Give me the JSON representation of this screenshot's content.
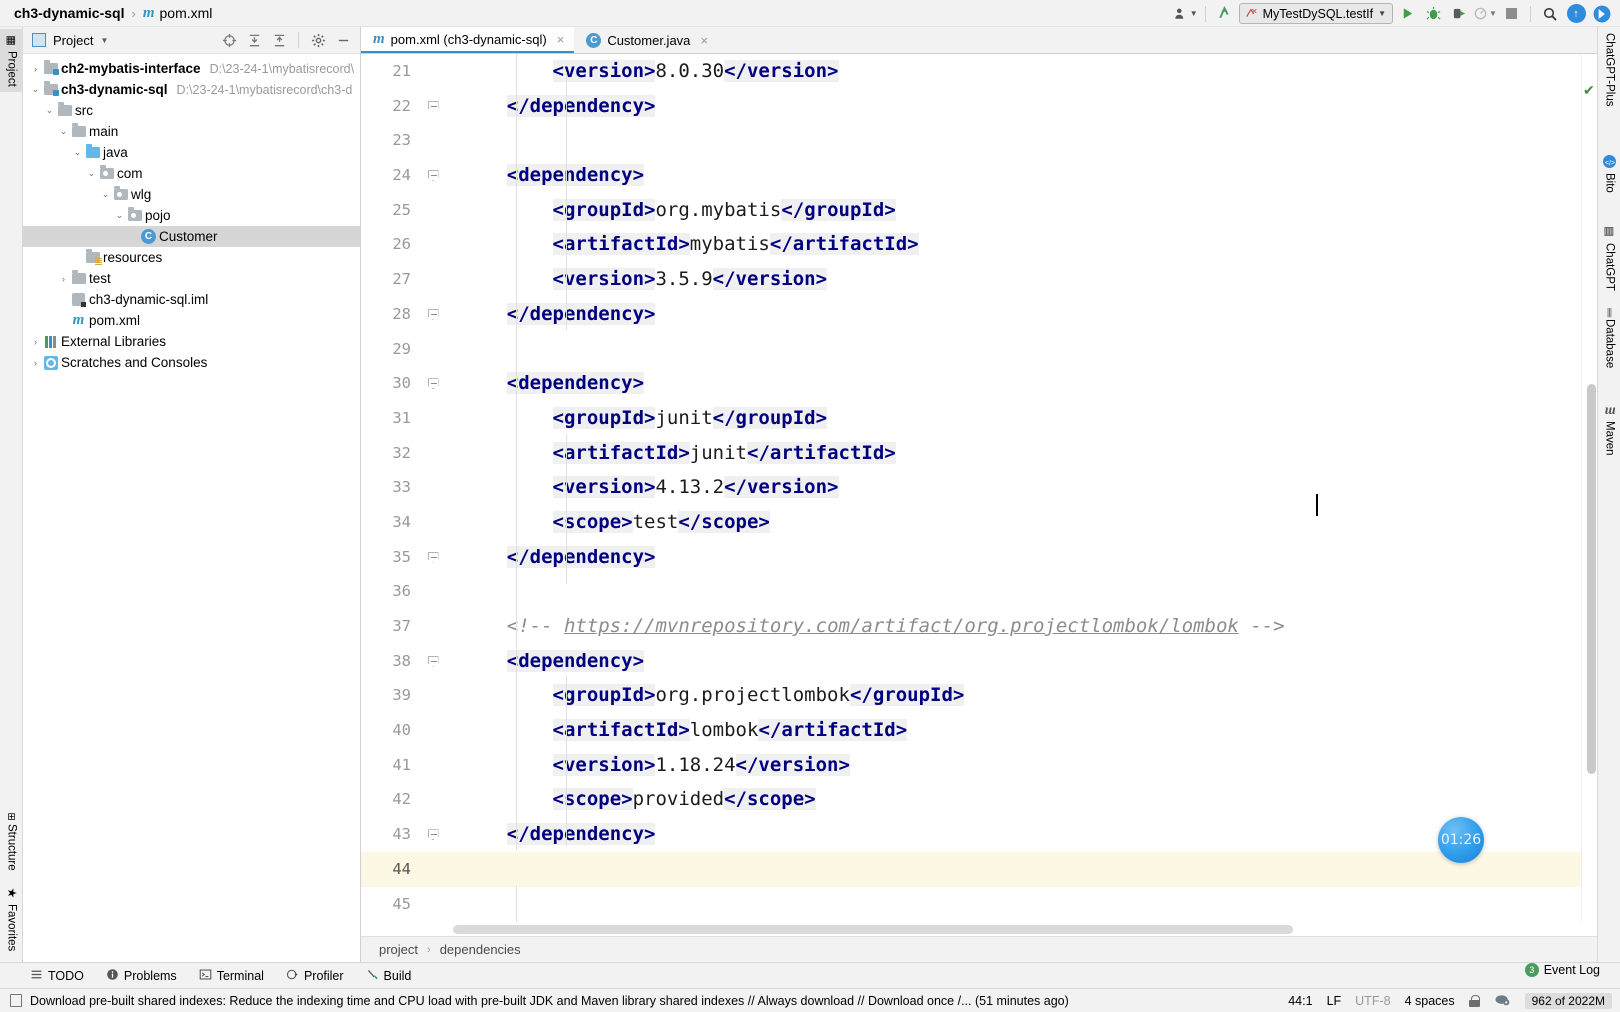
{
  "titlebar": {
    "project": "ch3-dynamic-sql",
    "separator": "›",
    "file": "pom.xml",
    "maven_icon": "m",
    "run_config": "MyTestDySQL.testIf",
    "icons": {
      "user": "user-icon",
      "updates": "update-arrow-icon",
      "run": "▶",
      "debug": "debug-icon",
      "run_coverage": "run-with-coverage-icon",
      "profile": "profile-icon",
      "stop": "stop-icon",
      "search": "⌕",
      "upload": "⬆",
      "forward": "➤"
    }
  },
  "left_rail": {
    "top": "Project",
    "bottom": [
      "Structure",
      "Favorites"
    ]
  },
  "project_panel": {
    "title": "Project",
    "toolbar_icons": [
      "locate-icon",
      "expand-all-icon",
      "collapse-all-icon",
      "settings-gear-icon",
      "hide-icon"
    ],
    "tree": [
      {
        "label": "ch2-mybatis-interface",
        "path": "D:\\23-24-1\\mybatisrecord\\",
        "arrow": "›",
        "icon": "module-folder",
        "indent": 0,
        "bold": true,
        "selected": false
      },
      {
        "label": "ch3-dynamic-sql",
        "path": "D:\\23-24-1\\mybatisrecord\\ch3-d",
        "arrow": "⌄",
        "icon": "module-folder",
        "indent": 0,
        "bold": true,
        "selected": false
      },
      {
        "label": "src",
        "path": "",
        "arrow": "⌄",
        "icon": "folder",
        "indent": 1,
        "bold": false,
        "selected": false
      },
      {
        "label": "main",
        "path": "",
        "arrow": "⌄",
        "icon": "folder",
        "indent": 2,
        "bold": false,
        "selected": false
      },
      {
        "label": "java",
        "path": "",
        "arrow": "⌄",
        "icon": "source-folder",
        "indent": 3,
        "bold": false,
        "selected": false
      },
      {
        "label": "com",
        "path": "",
        "arrow": "⌄",
        "icon": "package",
        "indent": 4,
        "bold": false,
        "selected": false
      },
      {
        "label": "wlg",
        "path": "",
        "arrow": "⌄",
        "icon": "package",
        "indent": 5,
        "bold": false,
        "selected": false
      },
      {
        "label": "pojo",
        "path": "",
        "arrow": "⌄",
        "icon": "package",
        "indent": 6,
        "bold": false,
        "selected": false
      },
      {
        "label": "Customer",
        "path": "",
        "arrow": "",
        "icon": "java-class",
        "indent": 7,
        "bold": false,
        "selected": true
      },
      {
        "label": "resources",
        "path": "",
        "arrow": "",
        "icon": "resource-folder",
        "indent": 3,
        "bold": false,
        "selected": false
      },
      {
        "label": "test",
        "path": "",
        "arrow": "›",
        "icon": "folder",
        "indent": 2,
        "bold": false,
        "selected": false
      },
      {
        "label": "ch3-dynamic-sql.iml",
        "path": "",
        "arrow": "",
        "icon": "iml-file",
        "indent": 2,
        "bold": false,
        "selected": false
      },
      {
        "label": "pom.xml",
        "path": "",
        "arrow": "",
        "icon": "maven-file",
        "indent": 2,
        "bold": false,
        "selected": false
      },
      {
        "label": "External Libraries",
        "path": "",
        "arrow": "›",
        "icon": "libraries",
        "indent": 0,
        "bold": false,
        "selected": false
      },
      {
        "label": "Scratches and Consoles",
        "path": "",
        "arrow": "›",
        "icon": "scratches",
        "indent": 0,
        "bold": false,
        "selected": false
      }
    ]
  },
  "editor": {
    "tabs": [
      {
        "label": "pom.xml (ch3-dynamic-sql)",
        "icon": "maven-file",
        "active": true,
        "close": "×"
      },
      {
        "label": "Customer.java",
        "icon": "java-class",
        "active": false,
        "close": "×"
      }
    ],
    "first_line_number": 21,
    "current_line": 44,
    "time_badge": "01:26",
    "lines": [
      {
        "n": 21,
        "fold": false,
        "segs": [
          {
            "t": "        ",
            "c": "txt"
          },
          {
            "t": "<version>",
            "c": "tag"
          },
          {
            "t": "8.0.30",
            "c": "txt"
          },
          {
            "t": "</version>",
            "c": "tag"
          }
        ]
      },
      {
        "n": 22,
        "fold": true,
        "segs": [
          {
            "t": "    ",
            "c": "txt"
          },
          {
            "t": "</dependency>",
            "c": "tag"
          }
        ]
      },
      {
        "n": 23,
        "fold": false,
        "segs": []
      },
      {
        "n": 24,
        "fold": true,
        "segs": [
          {
            "t": "    ",
            "c": "txt"
          },
          {
            "t": "<dependency>",
            "c": "tag"
          }
        ]
      },
      {
        "n": 25,
        "fold": false,
        "segs": [
          {
            "t": "        ",
            "c": "txt"
          },
          {
            "t": "<groupId>",
            "c": "tag"
          },
          {
            "t": "org.mybatis",
            "c": "txt"
          },
          {
            "t": "</groupId>",
            "c": "tag"
          }
        ]
      },
      {
        "n": 26,
        "fold": false,
        "segs": [
          {
            "t": "        ",
            "c": "txt"
          },
          {
            "t": "<artifactId>",
            "c": "tag"
          },
          {
            "t": "mybatis",
            "c": "txt"
          },
          {
            "t": "</artifactId>",
            "c": "tag"
          }
        ]
      },
      {
        "n": 27,
        "fold": false,
        "segs": [
          {
            "t": "        ",
            "c": "txt"
          },
          {
            "t": "<version>",
            "c": "tag"
          },
          {
            "t": "3.5.9",
            "c": "txt"
          },
          {
            "t": "</version>",
            "c": "tag"
          }
        ]
      },
      {
        "n": 28,
        "fold": true,
        "segs": [
          {
            "t": "    ",
            "c": "txt"
          },
          {
            "t": "</dependency>",
            "c": "tag"
          }
        ]
      },
      {
        "n": 29,
        "fold": false,
        "segs": []
      },
      {
        "n": 30,
        "fold": true,
        "segs": [
          {
            "t": "    ",
            "c": "txt"
          },
          {
            "t": "<dependency>",
            "c": "tag"
          }
        ]
      },
      {
        "n": 31,
        "fold": false,
        "segs": [
          {
            "t": "        ",
            "c": "txt"
          },
          {
            "t": "<groupId>",
            "c": "tag"
          },
          {
            "t": "junit",
            "c": "txt"
          },
          {
            "t": "</groupId>",
            "c": "tag"
          }
        ]
      },
      {
        "n": 32,
        "fold": false,
        "segs": [
          {
            "t": "        ",
            "c": "txt"
          },
          {
            "t": "<artifactId>",
            "c": "tag"
          },
          {
            "t": "junit",
            "c": "txt"
          },
          {
            "t": "</artifactId>",
            "c": "tag"
          }
        ]
      },
      {
        "n": 33,
        "fold": false,
        "segs": [
          {
            "t": "        ",
            "c": "txt"
          },
          {
            "t": "<version>",
            "c": "tag"
          },
          {
            "t": "4.13.2",
            "c": "txt"
          },
          {
            "t": "</version>",
            "c": "tag"
          }
        ]
      },
      {
        "n": 34,
        "fold": false,
        "segs": [
          {
            "t": "        ",
            "c": "txt"
          },
          {
            "t": "<scope>",
            "c": "tag"
          },
          {
            "t": "test",
            "c": "txt"
          },
          {
            "t": "</scope>",
            "c": "tag"
          }
        ]
      },
      {
        "n": 35,
        "fold": true,
        "segs": [
          {
            "t": "    ",
            "c": "txt"
          },
          {
            "t": "</dependency>",
            "c": "tag"
          }
        ]
      },
      {
        "n": 36,
        "fold": false,
        "segs": []
      },
      {
        "n": 37,
        "fold": false,
        "segs": [
          {
            "t": "    ",
            "c": "txt"
          },
          {
            "t": "<!-- ",
            "c": "cmt"
          },
          {
            "t": "https://mvnrepository.com/artifact/org.projectlombok/lombok",
            "c": "cmt-link"
          },
          {
            "t": " -->",
            "c": "cmt"
          }
        ]
      },
      {
        "n": 38,
        "fold": true,
        "segs": [
          {
            "t": "    ",
            "c": "txt"
          },
          {
            "t": "<dependency>",
            "c": "tag"
          }
        ]
      },
      {
        "n": 39,
        "fold": false,
        "segs": [
          {
            "t": "        ",
            "c": "txt"
          },
          {
            "t": "<groupId>",
            "c": "tag"
          },
          {
            "t": "org.projectlombok",
            "c": "txt"
          },
          {
            "t": "</groupId>",
            "c": "tag"
          }
        ]
      },
      {
        "n": 40,
        "fold": false,
        "segs": [
          {
            "t": "        ",
            "c": "txt"
          },
          {
            "t": "<artifactId>",
            "c": "tag"
          },
          {
            "t": "lombok",
            "c": "txt"
          },
          {
            "t": "</artifactId>",
            "c": "tag"
          }
        ]
      },
      {
        "n": 41,
        "fold": false,
        "segs": [
          {
            "t": "        ",
            "c": "txt"
          },
          {
            "t": "<version>",
            "c": "tag"
          },
          {
            "t": "1.18.24",
            "c": "txt"
          },
          {
            "t": "</version>",
            "c": "tag"
          }
        ]
      },
      {
        "n": 42,
        "fold": false,
        "segs": [
          {
            "t": "        ",
            "c": "txt"
          },
          {
            "t": "<scope>",
            "c": "tag"
          },
          {
            "t": "provided",
            "c": "txt"
          },
          {
            "t": "</scope>",
            "c": "tag"
          }
        ]
      },
      {
        "n": 43,
        "fold": true,
        "segs": [
          {
            "t": "    ",
            "c": "txt"
          },
          {
            "t": "</dependency>",
            "c": "tag"
          }
        ]
      },
      {
        "n": 44,
        "fold": false,
        "segs": []
      },
      {
        "n": 45,
        "fold": false,
        "segs": []
      }
    ],
    "breadcrumbs": [
      "project",
      "dependencies"
    ],
    "breadcrumb_separator": "›"
  },
  "right_rail": {
    "items": [
      {
        "label": "ChatGPT-Plus",
        "icon": "none"
      },
      {
        "label": "Bito",
        "icon": "bito-icon"
      },
      {
        "label": "ChatGPT",
        "icon": "chatgpt-icon"
      },
      {
        "label": "Database",
        "icon": "database-icon"
      },
      {
        "label": "Maven",
        "icon": "maven-icon"
      }
    ]
  },
  "bottom_toolbar": [
    {
      "label": "TODO",
      "icon": "todo-icon"
    },
    {
      "label": "Problems",
      "icon": "problems-icon"
    },
    {
      "label": "Terminal",
      "icon": "terminal-icon"
    },
    {
      "label": "Profiler",
      "icon": "profiler-icon"
    },
    {
      "label": "Build",
      "icon": "build-icon"
    }
  ],
  "status_bar": {
    "notification": "Download pre-built shared indexes: Reduce the indexing time and CPU load with pre-built JDK and Maven library shared indexes // Always download // Download once /... (51 minutes ago)",
    "caret_position": "44:1",
    "line_separator": "LF",
    "encoding": "UTF-8",
    "indent": "4 spaces",
    "memory": "962 of 2022M",
    "event_log": "Event Log",
    "event_log_count": "3"
  }
}
